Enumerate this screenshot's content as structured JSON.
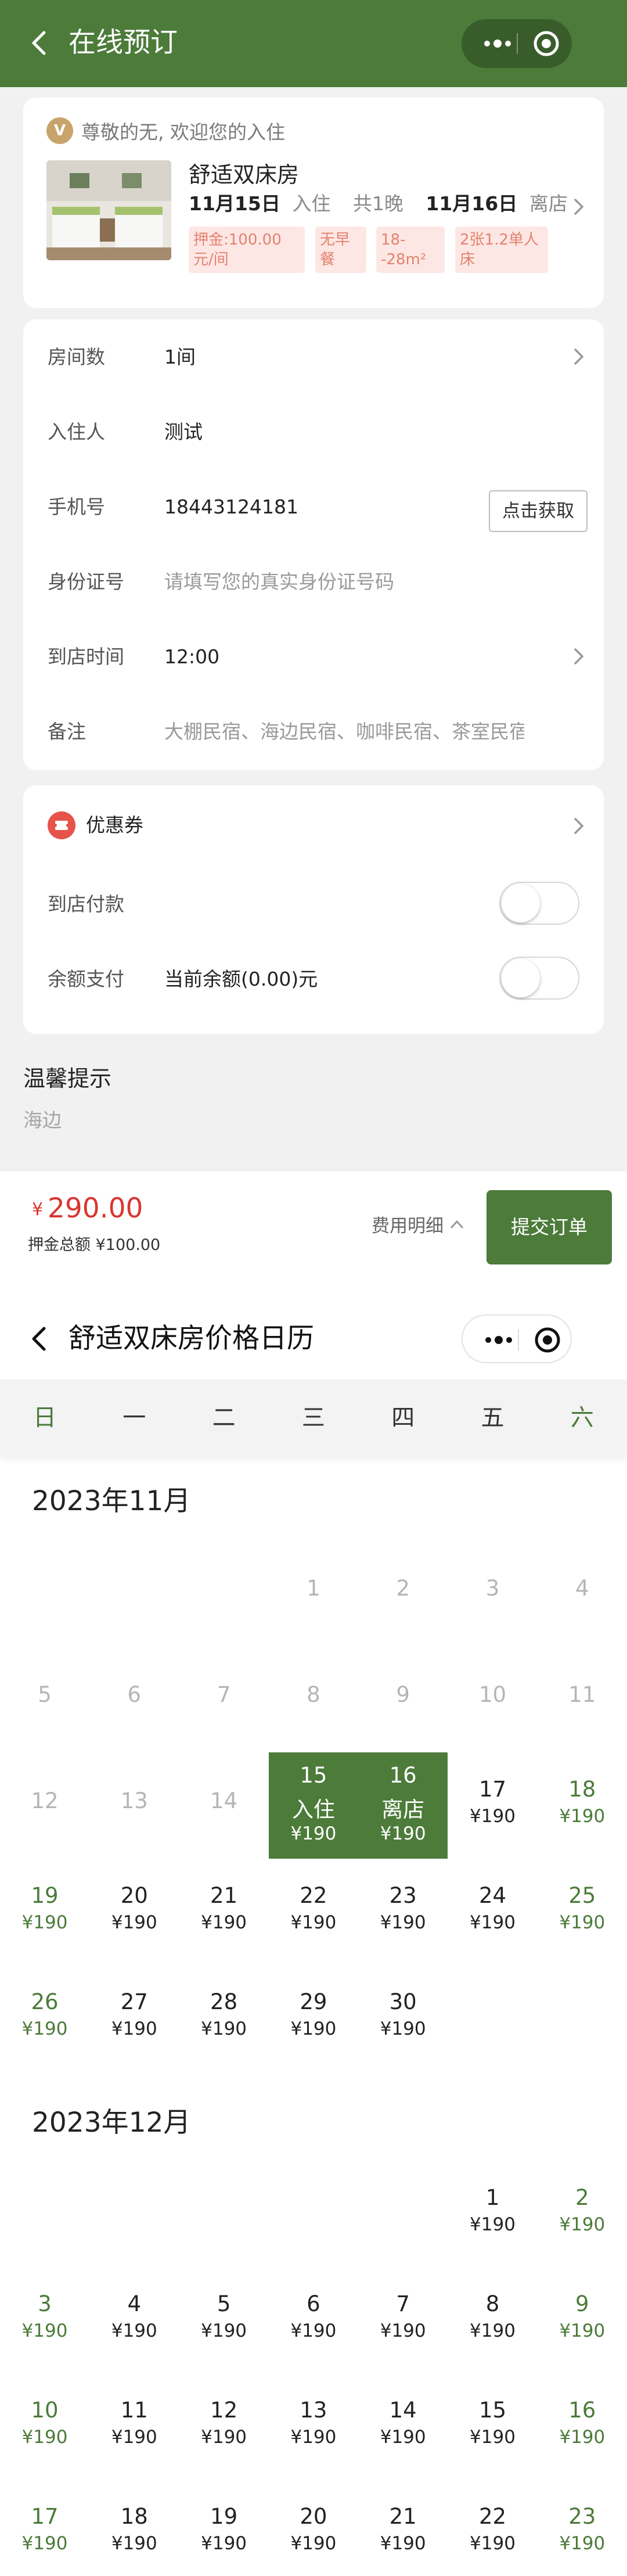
{
  "booking": {
    "nav": {
      "title": "在线预订"
    },
    "greeting": {
      "badge": "V",
      "text": "尊敬的无, 欢迎您的入住"
    },
    "room": {
      "name": "舒适双床房",
      "checkin_date": "11月15日",
      "checkin_label": "入住",
      "nights": "共1晚",
      "checkout_date": "11月16日",
      "checkout_label": "离店",
      "tags": [
        "押金:100.00\n元/间",
        "无早\n餐",
        "18-\n-28m²",
        "2张1.2单人\n床"
      ]
    },
    "form": {
      "rooms_label": "房间数",
      "rooms_value": "1间",
      "guest_label": "入住人",
      "guest_value": "测试",
      "phone_label": "手机号",
      "phone_value": "18443124181",
      "phone_button": "点击获取",
      "id_label": "身份证号",
      "id_placeholder": "请填写您的真实身份证号码",
      "arrival_label": "到店时间",
      "arrival_value": "12:00",
      "remark_label": "备注",
      "remark_placeholder": "大棚民宿、海边民宿、咖啡民宿、茶室民宿"
    },
    "payment": {
      "coupon_label": "优惠券",
      "pay_at_store_label": "到店付款",
      "pay_at_store_on": false,
      "balance_label": "余额支付",
      "balance_value": "当前余额(0.00)元",
      "balance_on": false
    },
    "tips": {
      "title": "温馨提示",
      "text": "海边"
    },
    "footer": {
      "currency": "¥",
      "price": "290.00",
      "deposit": "押金总额 ¥100.00",
      "detail_label": "费用明细",
      "submit_label": "提交订单"
    }
  },
  "calendar": {
    "nav": {
      "title": "舒适双床房价格日历"
    },
    "weekdays": [
      "日",
      "一",
      "二",
      "三",
      "四",
      "五",
      "六"
    ],
    "months": [
      {
        "title": "2023年11月",
        "first_weekday": 3,
        "days": 30,
        "past_before": 15,
        "price": "¥190",
        "checkin": {
          "day": 15,
          "label": "入住"
        },
        "checkout": {
          "day": 16,
          "label": "离店"
        }
      },
      {
        "title": "2023年12月",
        "first_weekday": 5,
        "days": 23,
        "past_before": 0,
        "price": "¥190"
      }
    ]
  },
  "colors": {
    "brand_green": "#4c7b3a",
    "price_red": "#d9362f",
    "tag_bg": "#fde7e4",
    "tag_text": "#e3826f",
    "page_bg": "#f1f1f1"
  },
  "icons": [
    "back-icon",
    "more-dots-icon",
    "capsule-close-icon",
    "chevron-right-icon",
    "vip-badge-icon",
    "coupon-icon",
    "chevron-up-icon"
  ]
}
